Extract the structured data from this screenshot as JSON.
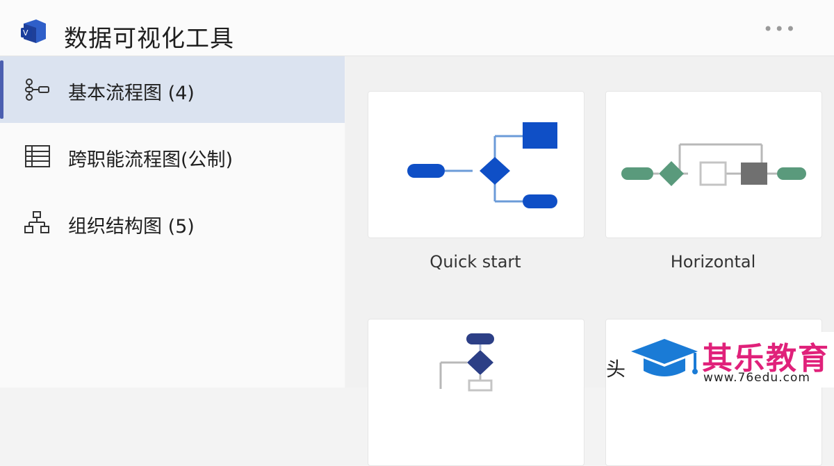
{
  "header": {
    "title": "数据可视化工具",
    "more_label": "•••"
  },
  "sidebar": {
    "items": [
      {
        "label": "基本流程图 (4)",
        "icon": "flowchart-icon",
        "active": true
      },
      {
        "label": "跨职能流程图(公制)",
        "icon": "table-grid-icon",
        "active": false
      },
      {
        "label": "组织结构图 (5)",
        "icon": "org-chart-icon",
        "active": false
      }
    ]
  },
  "templates": [
    {
      "label": "Quick start"
    },
    {
      "label": "Horizontal"
    },
    {
      "label": ""
    },
    {
      "label": ""
    }
  ],
  "brand": {
    "name": "其乐教育",
    "url": "www.76edu.com"
  },
  "stray_char": "头",
  "colors": {
    "accent": "#4b5fb0",
    "active_bg": "#dbe3f0",
    "blue": "#0f4fc6",
    "green": "#5a9a7c",
    "gray": "#707070",
    "brand_pink": "#e0217a",
    "brand_blue": "#1a7bd6"
  }
}
